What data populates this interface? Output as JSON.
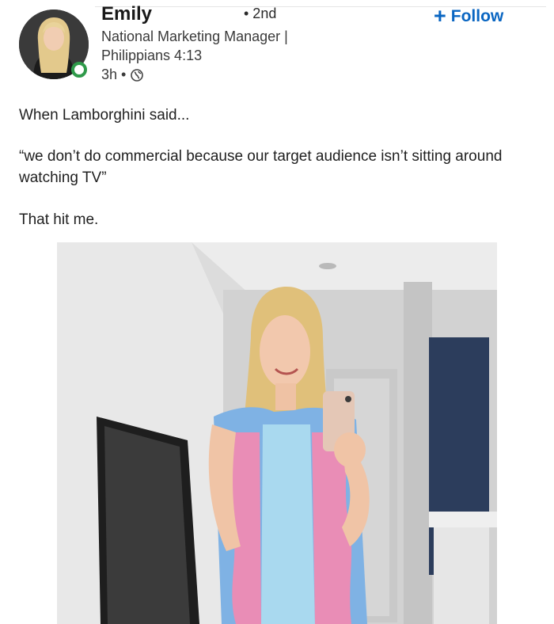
{
  "post": {
    "author": {
      "name": "Emily",
      "connection_degree": "• 2nd",
      "headline": "National Marketing Manager | Philippians 4:13",
      "timestamp": "3h •",
      "visibility_icon": "globe-icon",
      "presence_status": "online"
    },
    "follow_button": {
      "icon": "plus-icon",
      "label": "Follow"
    },
    "text": {
      "line1": "When Lamborghini said...",
      "quote": "“we don’t do commercial because our target audience isn’t sitting around watching TV”",
      "closing": "That hit me."
    },
    "photo": {
      "subject": "selfie-in-hallway"
    }
  },
  "colors": {
    "accent": "#0a66c2",
    "presence": "#2f9a4a",
    "text": "#1f1f1f"
  }
}
